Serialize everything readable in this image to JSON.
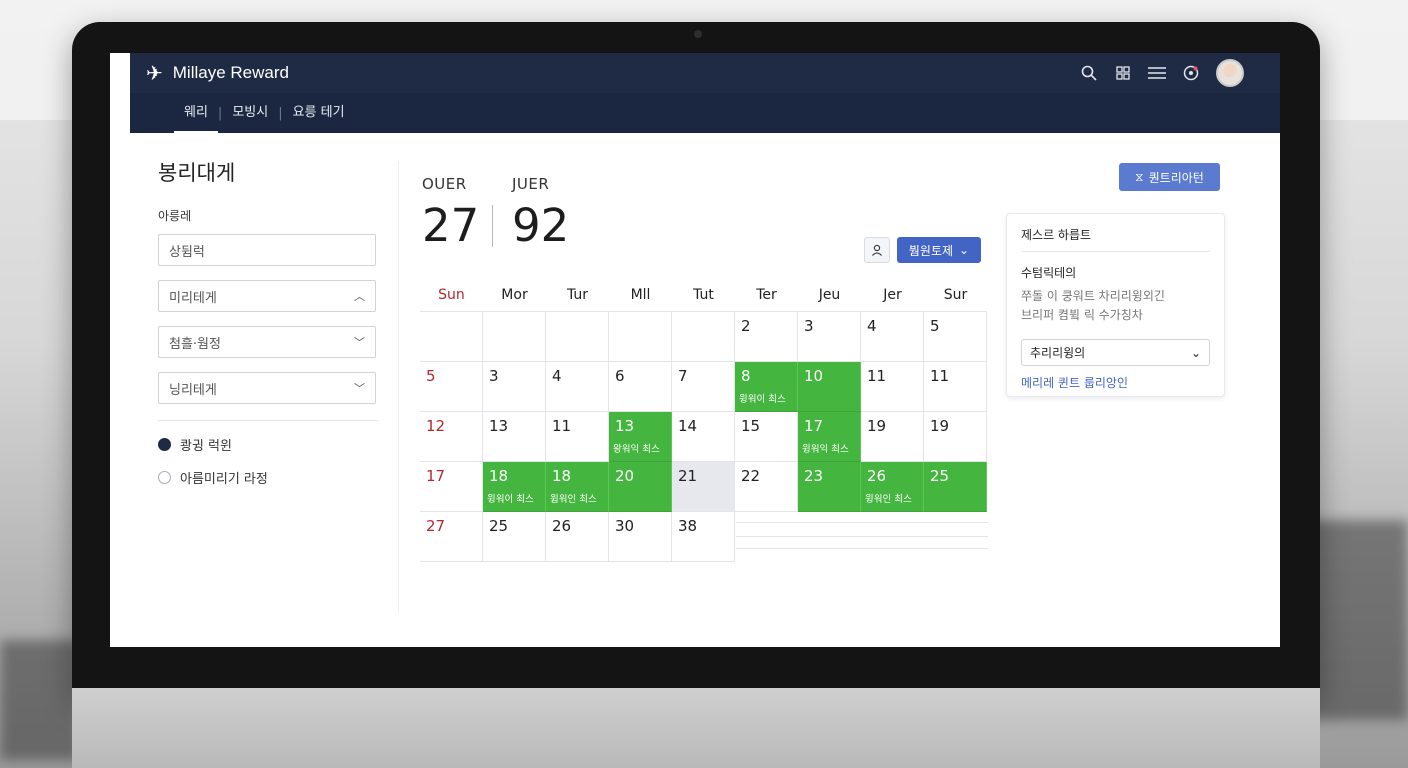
{
  "app": {
    "brand": "Millaye Reward"
  },
  "header": {
    "icons": [
      "search-icon",
      "grid-icon",
      "menu-icon",
      "notification-icon",
      "avatar"
    ]
  },
  "nav": {
    "tabs": [
      "웨리",
      "모빙시",
      "요릉 테기"
    ],
    "active_index": 0
  },
  "sidebar": {
    "title": "봉리대게",
    "label": "아릉레",
    "field1_placeholder": "상뒴럭",
    "select1": "미리테게",
    "select2": "첨흘·웜정",
    "select3": "닝리테게",
    "radio1": "쾅귕 럭윈",
    "radio2": "아름미리기 라정",
    "radio_selected": 0
  },
  "date_range": {
    "from_label": "OUER",
    "from_value": "27",
    "to_label": "JUER",
    "to_value": "92"
  },
  "toolbar": {
    "view_label": "붬원토제",
    "top_button": "퀀트리아턴"
  },
  "calendar": {
    "weekdays": [
      "Sun",
      "Mor",
      "Tur",
      "Mll",
      "Tut",
      "Ter",
      "Jeu",
      "Jer",
      "Sur"
    ],
    "rows": [
      [
        "",
        "",
        "",
        "",
        "",
        "2",
        "3",
        "4",
        "5"
      ],
      [
        "5",
        "3",
        "4",
        "6",
        "7",
        "8",
        "10",
        "11",
        "11"
      ],
      [
        "12",
        "13",
        "11",
        "13",
        "14",
        "15",
        "17",
        "19",
        "19"
      ],
      [
        "17",
        "18",
        "18",
        "20",
        "21",
        "22",
        "23",
        "26",
        "25"
      ],
      [
        "27",
        "25",
        "26",
        "30",
        "38",
        "",
        "",
        "",
        ""
      ]
    ],
    "event_label": "윙워이 최스",
    "events": [
      {
        "row": 1,
        "col": 5,
        "label": "윙워이 최스"
      },
      {
        "row": 2,
        "col": 3,
        "label": "왕워익 최스"
      },
      {
        "row": 2,
        "col": 6,
        "label": "윙워익 최스"
      },
      {
        "row": 3,
        "col": 1,
        "label": "윙워이 최스"
      },
      {
        "row": 3,
        "col": 2,
        "label": "윕워인 최스"
      },
      {
        "row": 3,
        "col": 7,
        "label": "윙워인 최스"
      }
    ]
  },
  "panel": {
    "title": "제스르 하릅트",
    "subtitle": "수텀릭테의",
    "desc_line1": "쭈돌 이 쿵워트 차리리윙외긴",
    "desc_line2": "브리퍼 켬뷬 릭 수가칭차",
    "select_value": "추리리윙의",
    "link": "메리레 퀸트 룹리앙인"
  },
  "colors": {
    "header": "#1f2a44",
    "accent": "#4264c5",
    "event_green": "#44b53e",
    "sunday_red": "#b3272d"
  }
}
